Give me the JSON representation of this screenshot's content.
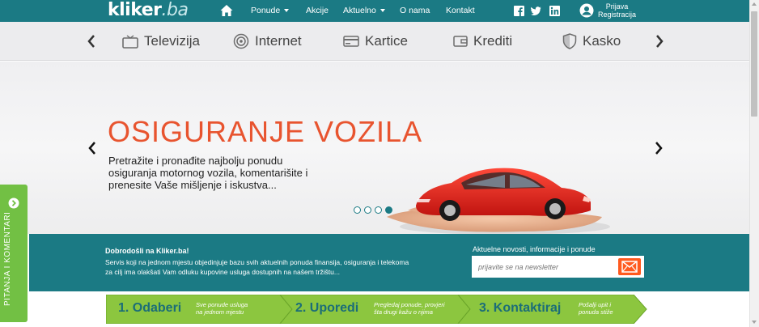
{
  "header": {
    "logo_main": "kliker",
    "logo_suffix": ".ba",
    "nav": [
      {
        "label": "Ponude",
        "has_dropdown": true
      },
      {
        "label": "Akcije",
        "has_dropdown": false
      },
      {
        "label": "Aktuelno",
        "has_dropdown": true
      },
      {
        "label": "O nama",
        "has_dropdown": false
      },
      {
        "label": "Kontakt",
        "has_dropdown": false
      }
    ],
    "social_icons": [
      "facebook-icon",
      "twitter-icon",
      "linkedin-icon"
    ],
    "login_line1": "Prijava",
    "login_line2": "Registracija"
  },
  "categories": [
    {
      "label": "Televizija",
      "icon": "tv-icon"
    },
    {
      "label": "Internet",
      "icon": "wifi-icon"
    },
    {
      "label": "Kartice",
      "icon": "card-icon"
    },
    {
      "label": "Krediti",
      "icon": "wallet-icon"
    },
    {
      "label": "Kasko",
      "icon": "shield-icon"
    }
  ],
  "hero": {
    "title": "OSIGURANJE VOZILA",
    "text": "Pretražite i pronađite najbolju ponudu osiguranja motornog vozila, komentarišite i prenesite Vaše mišljenje i iskustva...",
    "slide_count": 4,
    "active_slide": 4
  },
  "info": {
    "welcome_title": "Dobrodošli na Kliker.ba!",
    "welcome_text": "Servis koji na jednom mjestu objedinjuje bazu svih aktuelnih ponuda finansija, osiguranja i telekoma za cilj ima olakšati Vam odluku kupovine usluga dostupnih na našem tržištu...",
    "news_label": "Aktuelne novosti, informacije i ponude",
    "newsletter_placeholder": "prijavite se na newsletter"
  },
  "steps": [
    {
      "title": "1. Odaberi",
      "sub1": "Sve ponude usluga",
      "sub2": "na jednom mjestu"
    },
    {
      "title": "2. Uporedi",
      "sub1": "Pregledaj ponude, provjeri",
      "sub2": "šta drugi kažu o njima"
    },
    {
      "title": "3. Kontaktiraj",
      "sub1": "Pošalji upit i",
      "sub2": "ponuda stiže"
    }
  ],
  "side_tab": {
    "label": "PITANJA I KOMENTARI"
  },
  "colors": {
    "teal": "#1b7a84",
    "orange": "#e8542f",
    "green": "#72c044",
    "newsletter_button": "#ff5a1f"
  }
}
